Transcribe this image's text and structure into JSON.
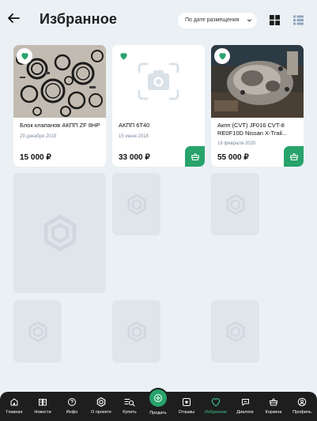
{
  "header": {
    "title": "Избранное",
    "sort_label": "По дате размещения"
  },
  "products": [
    {
      "name": "Блок клапанов АКПП ZF 8HP",
      "date": "29 декабря 2019",
      "price": "15 000 ₽",
      "photo": "valve-parts-photo",
      "has_cart": false
    },
    {
      "name": "АКПП 6T40",
      "date": "15 июня 2018",
      "price": "33 000 ₽",
      "photo": "camera-placeholder-icon",
      "has_cart": true
    },
    {
      "name": "Акпп (CVT) JF016 CVT-8 RE0F10D Nissan X-Trail...",
      "date": "16 февраля 2020",
      "price": "55 000 ₽",
      "photo": "transmission-photo",
      "has_cart": true
    }
  ],
  "nav": {
    "items": [
      {
        "label": "Главная",
        "icon": "home-icon"
      },
      {
        "label": "Новости",
        "icon": "newspaper-icon"
      },
      {
        "label": "Инфо",
        "icon": "info-icon"
      },
      {
        "label": "О проекте",
        "icon": "gear-logo-icon"
      },
      {
        "label": "Купить",
        "icon": "search-list-icon"
      },
      {
        "label": "Продать",
        "icon": "plus-icon"
      },
      {
        "label": "Отзывы",
        "icon": "star-icon"
      },
      {
        "label": "Избранное",
        "icon": "heart-icon"
      },
      {
        "label": "Диалоги",
        "icon": "chat-icon"
      },
      {
        "label": "Корзина",
        "icon": "basket-icon"
      },
      {
        "label": "Профиль",
        "icon": "user-icon"
      }
    ],
    "active": "Избранное"
  },
  "colors": {
    "accent": "#27a36b",
    "background": "#eaf0f4",
    "nav_background": "#1e1e1e",
    "placeholder": "#dfe5ea"
  }
}
